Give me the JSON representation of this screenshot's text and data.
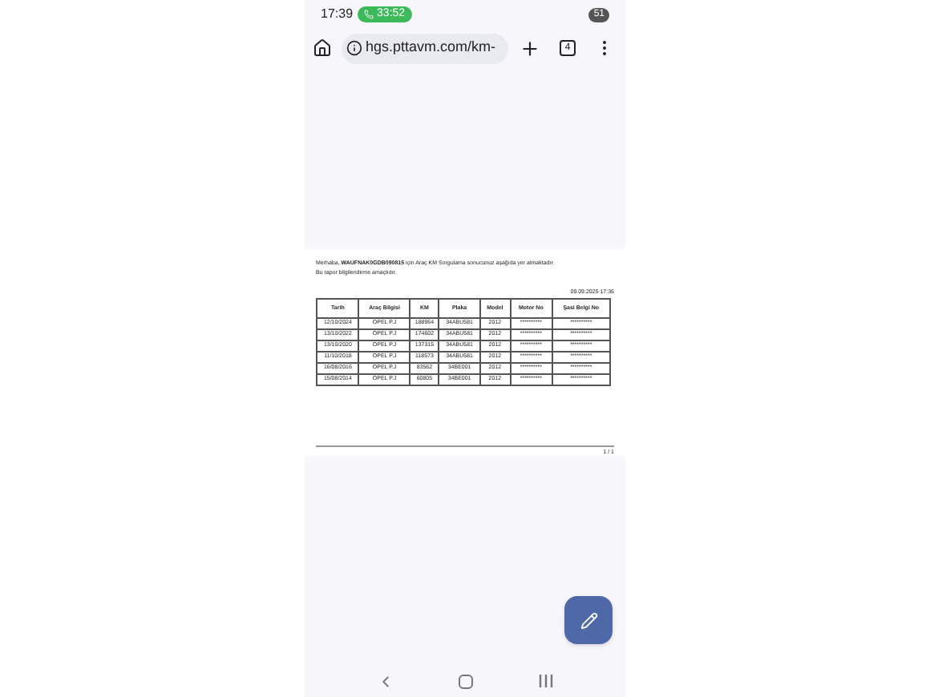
{
  "status_bar": {
    "time": "17:39",
    "call_timer": "33:52",
    "battery": "51"
  },
  "browser": {
    "url": "hgs.pttavm.com/km-",
    "tab_count": "4"
  },
  "document": {
    "greeting": "Merhaba, **WAUFNAK0GDB090815** için Araç KM Sorgulama sonucunuz aşağıda yer almaktadır.",
    "note": "Bu rapor bilgilendirme amaçlıdır.",
    "date": "09.09.2025 17:36",
    "columns": [
      "Tarih",
      "Araç Bilgisi",
      "KM",
      "Plaka",
      "Model",
      "Motor No",
      "Şasi Belgi No"
    ],
    "rows": [
      [
        "12/10/2024",
        "OPEL P.J",
        "188964",
        "34ABU581",
        "2012",
        "**********",
        "**********"
      ],
      [
        "13/10/2022",
        "OPEL P.J",
        "174602",
        "34ABU581",
        "2012",
        "**********",
        "**********"
      ],
      [
        "13/10/2020",
        "OPEL P.J",
        "137315",
        "34ABU581",
        "2012",
        "**********",
        "**********"
      ],
      [
        "11/10/2018",
        "OPEL P.J",
        "118573",
        "34ABU581",
        "2012",
        "**********",
        "**********"
      ],
      [
        "16/08/2016",
        "OPEL P.J",
        "83562",
        "34BE001",
        "2012",
        "**********",
        "**********"
      ],
      [
        "15/08/2014",
        "OPEL P.J",
        "60805",
        "34BE001",
        "2012",
        "**********",
        "**********"
      ]
    ],
    "page_number": "1 / 1"
  }
}
